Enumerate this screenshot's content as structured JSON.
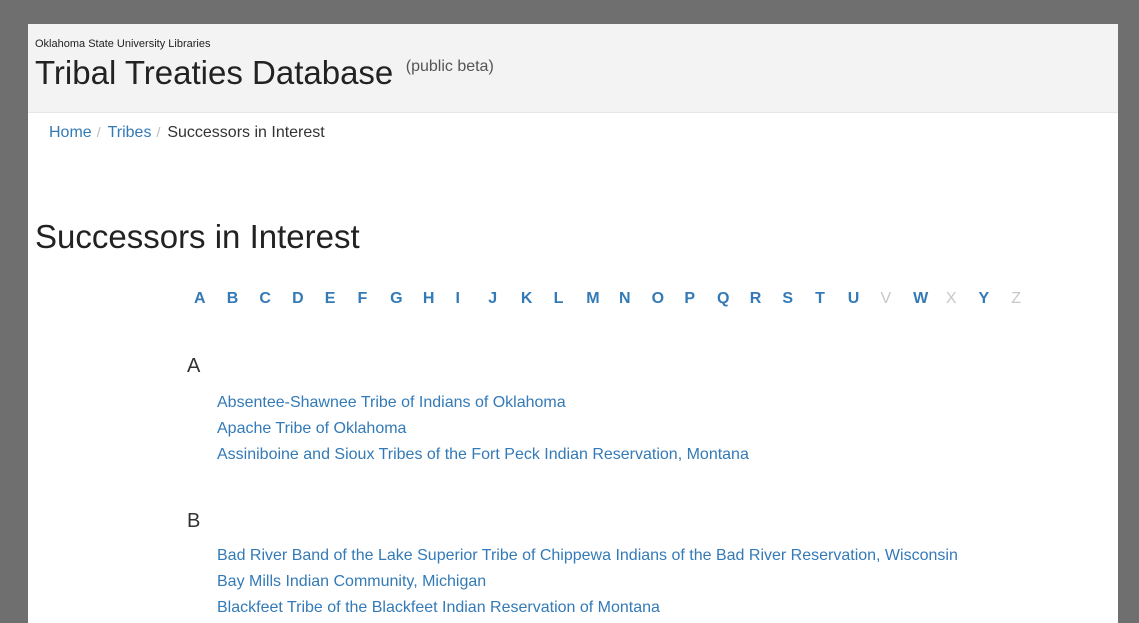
{
  "header": {
    "org": "Oklahoma State University Libraries",
    "title": "Tribal Treaties Database",
    "beta": "(public beta)"
  },
  "breadcrumb": {
    "home": "Home",
    "tribes": "Tribes",
    "current": "Successors in Interest",
    "separator": "/"
  },
  "page_title": "Successors in Interest",
  "alphabet": [
    {
      "letter": "A",
      "enabled": true
    },
    {
      "letter": "B",
      "enabled": true
    },
    {
      "letter": "C",
      "enabled": true
    },
    {
      "letter": "D",
      "enabled": true
    },
    {
      "letter": "E",
      "enabled": true
    },
    {
      "letter": "F",
      "enabled": true
    },
    {
      "letter": "G",
      "enabled": true
    },
    {
      "letter": "H",
      "enabled": true
    },
    {
      "letter": "I",
      "enabled": true
    },
    {
      "letter": "J",
      "enabled": true
    },
    {
      "letter": "K",
      "enabled": true
    },
    {
      "letter": "L",
      "enabled": true
    },
    {
      "letter": "M",
      "enabled": true
    },
    {
      "letter": "N",
      "enabled": true
    },
    {
      "letter": "O",
      "enabled": true
    },
    {
      "letter": "P",
      "enabled": true
    },
    {
      "letter": "Q",
      "enabled": true
    },
    {
      "letter": "R",
      "enabled": true
    },
    {
      "letter": "S",
      "enabled": true
    },
    {
      "letter": "T",
      "enabled": true
    },
    {
      "letter": "U",
      "enabled": true
    },
    {
      "letter": "V",
      "enabled": false
    },
    {
      "letter": "W",
      "enabled": true
    },
    {
      "letter": "X",
      "enabled": false
    },
    {
      "letter": "Y",
      "enabled": true
    },
    {
      "letter": "Z",
      "enabled": false
    }
  ],
  "sections": [
    {
      "letter": "A",
      "tribes": [
        "Absentee-Shawnee Tribe of Indians of Oklahoma",
        "Apache Tribe of Oklahoma",
        "Assiniboine and Sioux Tribes of the Fort Peck Indian Reservation, Montana"
      ]
    },
    {
      "letter": "B",
      "tribes": [
        "Bad River Band of the Lake Superior Tribe of Chippewa Indians of the Bad River Reservation, Wisconsin",
        "Bay Mills Indian Community, Michigan",
        "Blackfeet Tribe of the Blackfeet Indian Reservation of Montana"
      ]
    }
  ],
  "colors": {
    "link": "#337ab7",
    "disabled": "#c7c7c7",
    "header_bg": "#f3f3f3",
    "frame": "#6f6f6f"
  }
}
